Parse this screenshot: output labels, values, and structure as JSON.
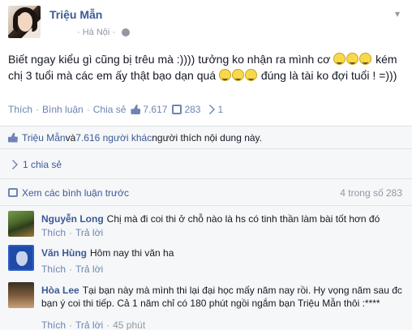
{
  "post": {
    "author": "Triệu Mẫn",
    "location": "· Hà Nội ·",
    "text_part1": "Biết ngay kiểu gì cũng bị trêu mà :)))) tưởng ko nhận ra mình cơ ",
    "text_part2": " kém chị 3 tuổi mà các em ấy thật bạo dạn quá ",
    "text_part3": " đúng là tài ko đợi tuổi ! =)))",
    "actions": {
      "like": "Thích",
      "comment": "Bình luận",
      "share": "Chia sẻ",
      "like_count": "7.617",
      "comment_count": "283",
      "share_count": "1"
    }
  },
  "feedback": {
    "likes_name": "Triệu Mẫn",
    "likes_and": " và ",
    "likes_others": "7.616 người khác",
    "likes_suffix": " người thích nội dung này.",
    "shares": "1 chia sẻ",
    "view_more": "Xem các bình luận trước",
    "page_count": "4 trong số 283"
  },
  "comments": [
    {
      "name": "Nguyễn Long",
      "text": "Chị mà đi coi thi ở chỗ nào là hs có tinh thần làm bài tốt hơn đó",
      "like": "Thích",
      "reply": "Trả lời",
      "time": ""
    },
    {
      "name": "Văn Hùng",
      "text": "Hôm nay thi văn ha",
      "like": "Thích",
      "reply": "Trả lời",
      "time": ""
    },
    {
      "name": "Hòa Lee",
      "text": "Tại bạn này mà mình thi lại đại học mấy năm nay rồi. Hy vọng năm sau đc bạn ý coi thi tiếp. Cả 1 năm chỉ có 180 phút ngồi ngắm bạn Triệu Mẫn thôi :****",
      "like": "Thích",
      "reply": "Trả lời",
      "time": "45 phút"
    }
  ],
  "colors": {
    "link": "#3b5998",
    "muted": "#9197a3",
    "action": "#6d84b4",
    "feedback_bg": "#f6f7f8"
  },
  "icons": [
    "globe-icon",
    "chevron-down-icon",
    "thumbs-up-icon",
    "comment-icon",
    "share-icon",
    "grin-emoji-icon"
  ]
}
